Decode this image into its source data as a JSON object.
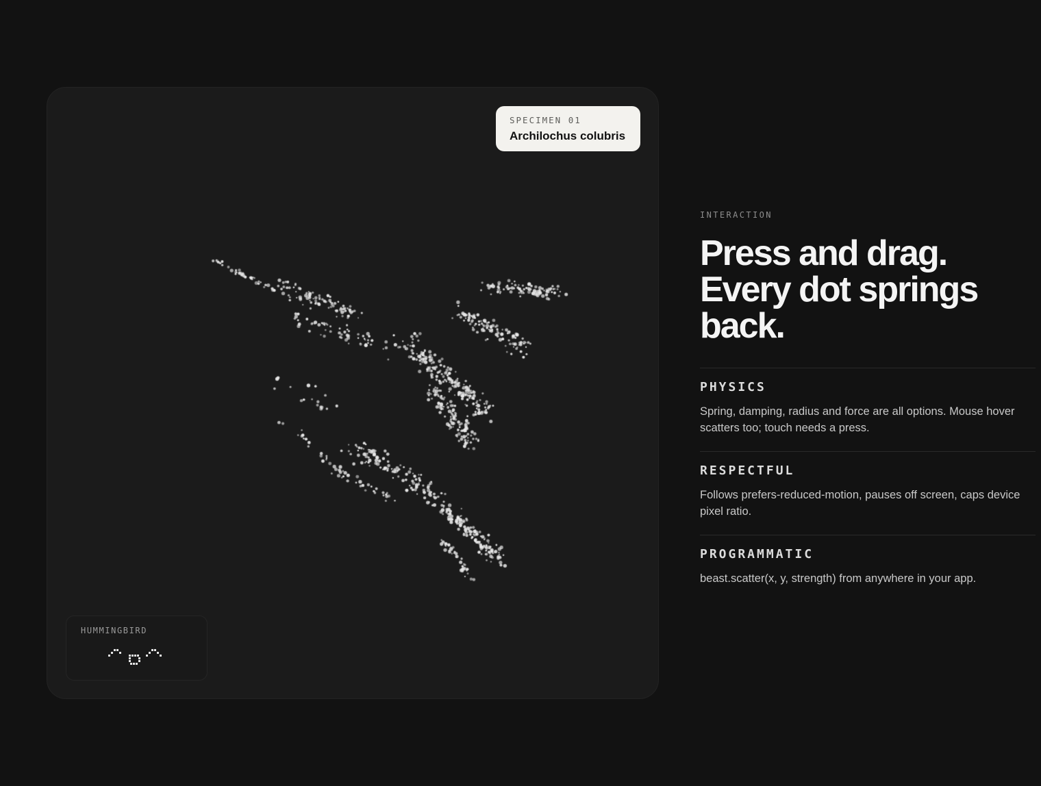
{
  "stage": {
    "background": "#1b1b1b",
    "dot_color": "#e8e8e8",
    "specimen": {
      "eyebrow": "SPECIMEN 01",
      "name": "Archilochus colubris"
    },
    "creature_chip": {
      "label": "HUMMINGBIRD",
      "icon": "hummingbird-pixel-icon"
    }
  },
  "info": {
    "eyebrow": "INTERACTION",
    "headline_lines": [
      "Press and drag.",
      "Every dot springs",
      "back."
    ],
    "features": [
      {
        "title": "PHYSICS",
        "body": "Spring, damping, radius and force are all options. Mouse hover scatters too; touch needs a press."
      },
      {
        "title": "RESPECTFUL",
        "body": "Follows prefers-reduced-motion, pauses off screen, caps device pixel ratio."
      },
      {
        "title": "PROGRAMMATIC",
        "body": "beast.scatter(x, y, strength) from anywhere in your app."
      }
    ]
  }
}
